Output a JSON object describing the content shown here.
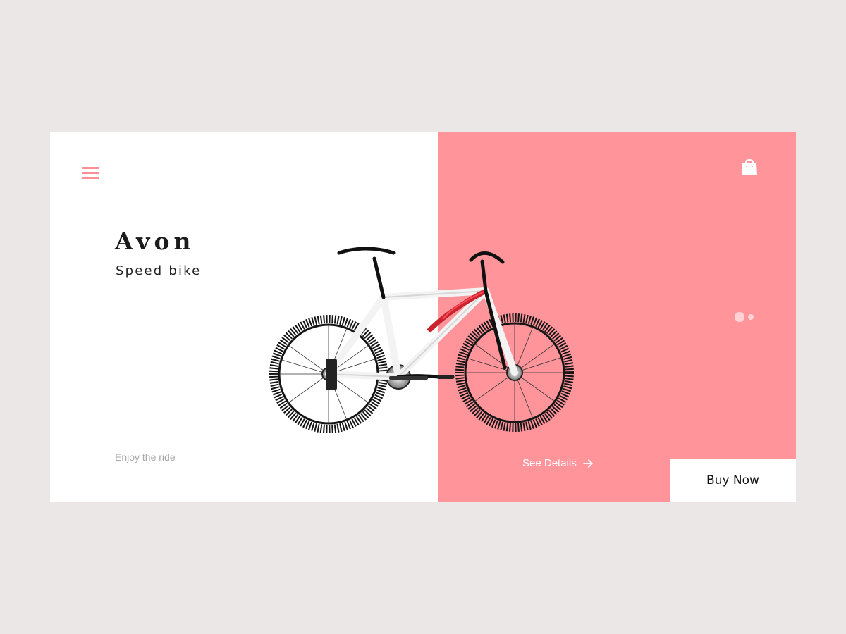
{
  "product": {
    "name": "Avon",
    "type": "Speed bike",
    "tagline": "Enjoy the ride"
  },
  "actions": {
    "details_label": "See Details",
    "buy_label": "Buy Now"
  },
  "icons": {
    "menu": "hamburger-menu-icon",
    "bag": "shopping-bag-icon",
    "arrow": "arrow-right-icon"
  },
  "carousel": {
    "slides": 2,
    "active_slide": 1
  },
  "colors": {
    "accent": "#ff949b",
    "background": "#ebe7e6",
    "card": "#ffffff"
  }
}
